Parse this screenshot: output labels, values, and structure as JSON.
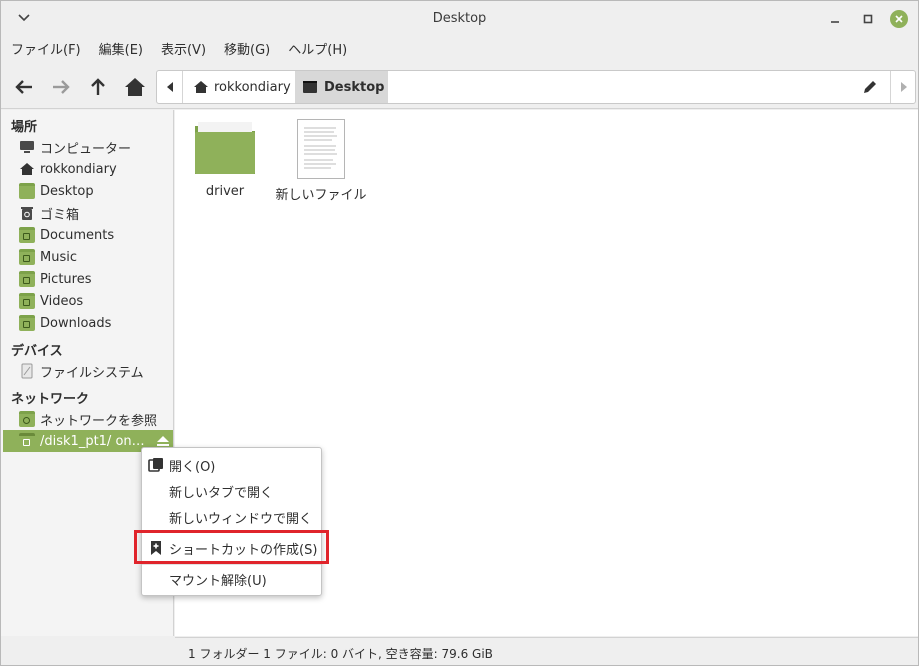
{
  "window": {
    "title": "Desktop"
  },
  "menubar": [
    "ファイル(F)",
    "編集(E)",
    "表示(V)",
    "移動(G)",
    "ヘルプ(H)"
  ],
  "pathbar": {
    "home_label": "rokkondiary",
    "current_label": "Desktop"
  },
  "sidebar": {
    "places_header": "場所",
    "places": [
      {
        "label": "コンピューター",
        "icon": "computer-icon"
      },
      {
        "label": "rokkondiary",
        "icon": "home-icon"
      },
      {
        "label": "Desktop",
        "icon": "desktop-folder-icon"
      },
      {
        "label": "ゴミ箱",
        "icon": "trash-icon"
      },
      {
        "label": "Documents",
        "icon": "documents-folder-icon"
      },
      {
        "label": "Music",
        "icon": "music-folder-icon"
      },
      {
        "label": "Pictures",
        "icon": "pictures-folder-icon"
      },
      {
        "label": "Videos",
        "icon": "videos-folder-icon"
      },
      {
        "label": "Downloads",
        "icon": "downloads-folder-icon"
      }
    ],
    "devices_header": "デバイス",
    "devices": [
      {
        "label": "ファイルシステム",
        "icon": "drive-icon"
      }
    ],
    "network_header": "ネットワーク",
    "network": [
      {
        "label": "ネットワークを参照",
        "icon": "network-folder-icon"
      },
      {
        "label": "/disk1_pt1/ on ...",
        "icon": "network-share-icon"
      }
    ]
  },
  "files": [
    {
      "label": "driver",
      "icon": "folder-icon"
    },
    {
      "label": "新しいファイル",
      "icon": "text-file-icon"
    }
  ],
  "context_menu": {
    "items": [
      "開く(O)",
      "新しいタブで開く",
      "新しいウィンドウで開く",
      "ショートカットの作成(S)",
      "マウント解除(U)"
    ]
  },
  "statusbar": {
    "text": "1 フォルダー 1 ファイル: 0 バイト, 空き容量: 79.6 GiB"
  },
  "colors": {
    "accent": "#8fb15a",
    "highlight": "#e0242b"
  }
}
